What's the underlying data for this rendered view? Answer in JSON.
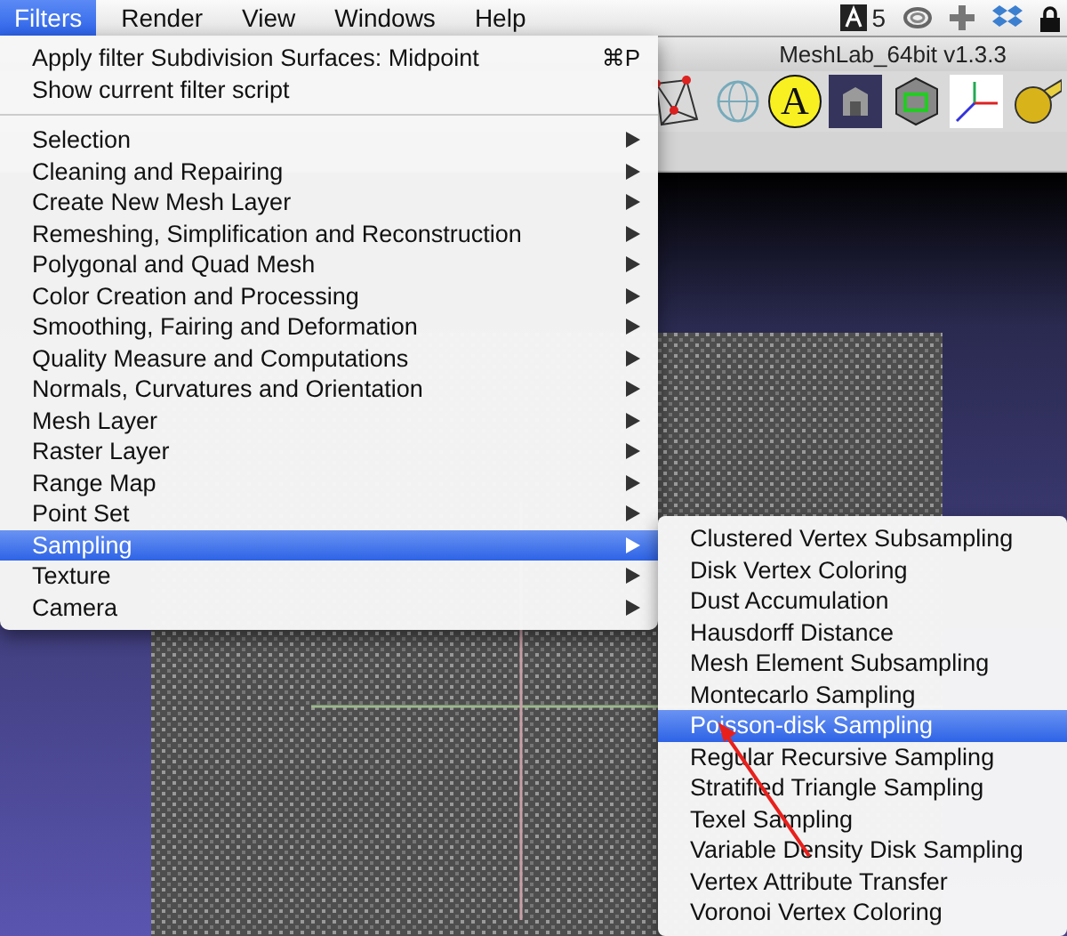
{
  "menubar": {
    "items": [
      {
        "label": "Filters",
        "selected": true
      },
      {
        "label": "Render",
        "selected": false
      },
      {
        "label": "View",
        "selected": false
      },
      {
        "label": "Windows",
        "selected": false
      },
      {
        "label": "Help",
        "selected": false
      }
    ],
    "status_count": "5"
  },
  "window": {
    "title": "MeshLab_64bit v1.3.3",
    "annotation_label": "A"
  },
  "filters_menu": {
    "actions": [
      {
        "label": "Apply filter Subdivision Surfaces: Midpoint",
        "shortcut": "⌘P"
      },
      {
        "label": "Show current filter script"
      }
    ],
    "categories": [
      {
        "label": "Selection",
        "selected": false
      },
      {
        "label": "Cleaning and Repairing",
        "selected": false
      },
      {
        "label": "Create New Mesh Layer",
        "selected": false
      },
      {
        "label": "Remeshing, Simplification and Reconstruction",
        "selected": false
      },
      {
        "label": "Polygonal and Quad Mesh",
        "selected": false
      },
      {
        "label": "Color Creation and Processing",
        "selected": false
      },
      {
        "label": "Smoothing, Fairing and Deformation",
        "selected": false
      },
      {
        "label": "Quality Measure and Computations",
        "selected": false
      },
      {
        "label": "Normals, Curvatures and Orientation",
        "selected": false
      },
      {
        "label": "Mesh Layer",
        "selected": false
      },
      {
        "label": "Raster Layer",
        "selected": false
      },
      {
        "label": "Range Map",
        "selected": false
      },
      {
        "label": "Point Set",
        "selected": false
      },
      {
        "label": "Sampling",
        "selected": true
      },
      {
        "label": "Texture",
        "selected": false
      },
      {
        "label": "Camera",
        "selected": false
      }
    ]
  },
  "sampling_submenu": {
    "items": [
      {
        "label": "Clustered Vertex Subsampling",
        "selected": false
      },
      {
        "label": "Disk Vertex Coloring",
        "selected": false
      },
      {
        "label": "Dust Accumulation",
        "selected": false
      },
      {
        "label": "Hausdorff Distance",
        "selected": false
      },
      {
        "label": "Mesh Element Subsampling",
        "selected": false
      },
      {
        "label": "Montecarlo Sampling",
        "selected": false
      },
      {
        "label": "Poisson-disk Sampling",
        "selected": true
      },
      {
        "label": "Regular Recursive Sampling",
        "selected": false
      },
      {
        "label": "Stratified Triangle Sampling",
        "selected": false
      },
      {
        "label": "Texel Sampling",
        "selected": false
      },
      {
        "label": "Variable Density Disk Sampling",
        "selected": false
      },
      {
        "label": "Vertex Attribute Transfer",
        "selected": false
      },
      {
        "label": "Voronoi Vertex Coloring",
        "selected": false
      }
    ]
  }
}
